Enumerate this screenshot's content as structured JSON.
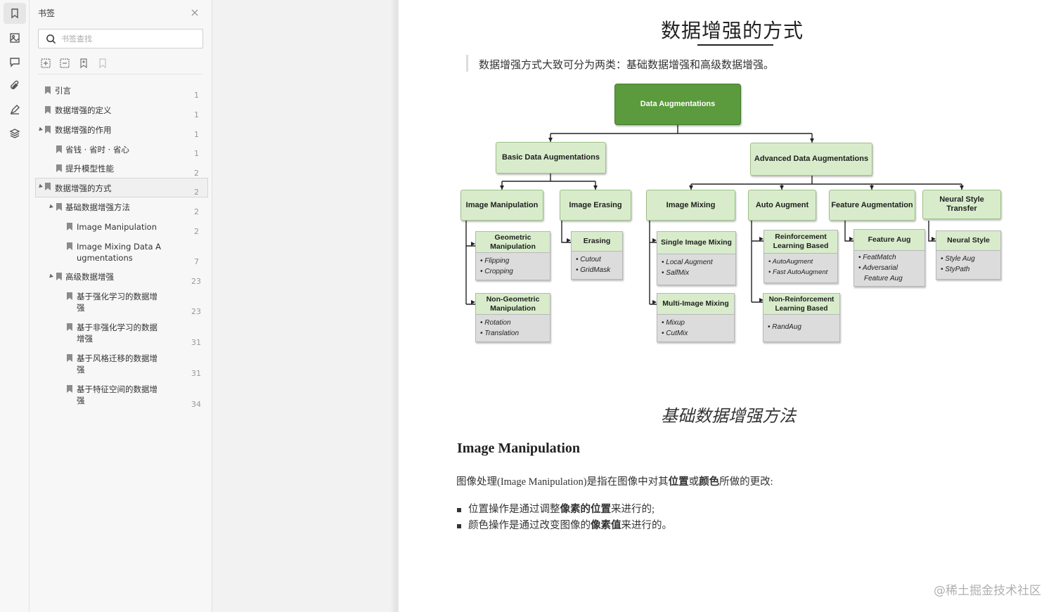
{
  "sidebar": {
    "title": "书签",
    "search_placeholder": "书签查找",
    "bookmarks": [
      {
        "label": "引言",
        "page": "1"
      },
      {
        "label": "数据增强的定义",
        "page": "1"
      },
      {
        "label": "数据增强的作用",
        "page": "1"
      },
      {
        "label": "省钱 · 省时 · 省心",
        "page": "1"
      },
      {
        "label": "提升模型性能",
        "page": "2"
      },
      {
        "label": "数据增强的方式",
        "page": "2"
      },
      {
        "label": "基础数据增强方法",
        "page": "2"
      },
      {
        "label": "Image Manipulation",
        "page": "2"
      },
      {
        "label": "Image Mixing Data A",
        "label2": "ugmentations",
        "page": "7"
      },
      {
        "label": "高级数据增强",
        "page": "23"
      },
      {
        "label": "基于强化学习的数据增",
        "label2": "强",
        "page": "23"
      },
      {
        "label": "基于非强化学习的数据",
        "label2": "增强",
        "page": "31"
      },
      {
        "label": "基于风格迁移的数据增",
        "label2": "强",
        "page": "31"
      },
      {
        "label": "基于特征空间的数据增",
        "label2": "强",
        "page": "34"
      }
    ]
  },
  "document": {
    "title": "数据增强的方式",
    "quote": "数据增强方式大致可分为两类：基础数据增强和高级数据增强。",
    "section_heading": "基础数据增强方法",
    "subheading": "Image Manipulation",
    "para": {
      "t1": "图像处理(Image Manipulation)是指在图像中对其",
      "b1": "位置",
      "t2": "或",
      "b2": "颜色",
      "t3": "所做的更改:"
    },
    "bullet1": {
      "t1": "位置操作是通过调整",
      "b1": "像素的位置",
      "t2": "来进行的;"
    },
    "bullet2": {
      "t1": "颜色操作是通过改变图像的",
      "b1": "像素值",
      "t2": "来进行的。"
    },
    "watermark": "@稀土掘金技术社区"
  },
  "diagram": {
    "root": "Data Augmentations",
    "basic": "Basic Data Augmentations",
    "advanced": "Advanced Data Augmentations",
    "image_manipulation": "Image Manipulation",
    "image_erasing": "Image Erasing",
    "image_mixing": "Image Mixing",
    "auto_augment": "Auto Augment",
    "feature_augmentation": "Feature Augmentation",
    "neural_style_transfer": "Neural Style Transfer",
    "geometric": {
      "title": "Geometric Manipulation",
      "items": [
        "• Flipping",
        "• Cropping"
      ]
    },
    "non_geometric": {
      "title": "Non-Geometric Manipulation",
      "items": [
        "• Rotation",
        "• Translation"
      ]
    },
    "erasing": {
      "title": "Erasing",
      "items": [
        "• Cutout",
        "• GridMask"
      ]
    },
    "single_mixing": {
      "title": "Single Image Mixing",
      "items": [
        "• Local Augment",
        "• SalfMix"
      ]
    },
    "multi_mixing": {
      "title": "Multi-Image Mixing",
      "items": [
        "• Mixup",
        "• CutMix"
      ]
    },
    "rl_based": {
      "title": "Reinforcement Learning Based",
      "items": [
        "• AutoAugment",
        "• Fast AutoAugment"
      ]
    },
    "non_rl_based": {
      "title": "Non-Reinforcement Learning Based",
      "items": [
        "• RandAug"
      ]
    },
    "feature_aug": {
      "title": "Feature Aug",
      "items": [
        "• FeatMatch",
        "• Adversarial",
        "  Feature Aug"
      ]
    },
    "neural_style": {
      "title": "Neural Style",
      "items": [
        "• Style Aug",
        "• StyPath"
      ]
    }
  }
}
